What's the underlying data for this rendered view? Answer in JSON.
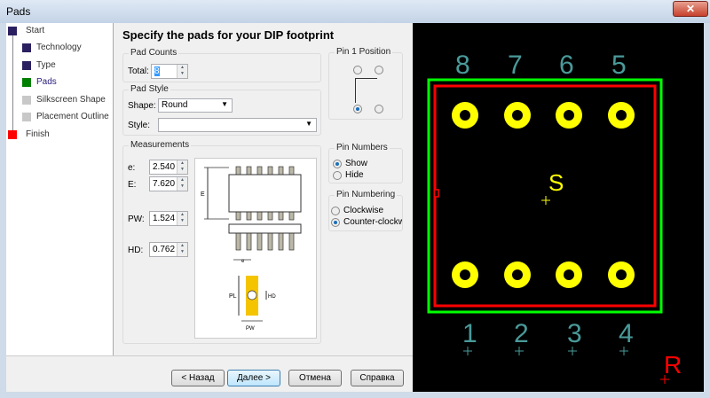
{
  "window": {
    "title": "Pads",
    "close": "✕"
  },
  "sidebar": {
    "items": [
      {
        "label": "Start",
        "color": "#2a2060"
      },
      {
        "label": "Technology",
        "color": "#2a2060"
      },
      {
        "label": "Type",
        "color": "#2a2060"
      },
      {
        "label": "Pads",
        "color": "#008000"
      },
      {
        "label": "Silkscreen Shape",
        "color": "#c8c8c8"
      },
      {
        "label": "Placement Outline",
        "color": "#c8c8c8"
      },
      {
        "label": "Finish",
        "color": "#ff0000"
      }
    ]
  },
  "main": {
    "heading": "Specify the pads for your DIP footprint",
    "pad_counts": {
      "legend": "Pad Counts",
      "total_label": "Total:",
      "total": "8"
    },
    "pad_style": {
      "legend": "Pad Style",
      "shape_label": "Shape:",
      "shape": "Round",
      "style_label": "Style:",
      "style": ""
    },
    "measurements": {
      "legend": "Measurements",
      "e_label": "e:",
      "e": "2.540",
      "E_label": "E:",
      "E": "7.620",
      "PW_label": "PW:",
      "PW": "1.524",
      "HD_label": "HD:",
      "HD": "0.762"
    },
    "diagram": {
      "E": "E",
      "e": "e",
      "PL": "PL",
      "HD": "HD",
      "PW": "PW"
    },
    "pin1": {
      "legend": "Pin 1 Position"
    },
    "pin_numbers": {
      "legend": "Pin Numbers",
      "show": "Show",
      "hide": "Hide"
    },
    "pin_numbering": {
      "legend": "Pin Numbering",
      "cw": "Clockwise",
      "ccw": "Counter-clockwis"
    }
  },
  "buttons": {
    "back": "< Назад",
    "next": "Далее >",
    "cancel": "Отмена",
    "help": "Справка"
  },
  "preview": {
    "top_pins": [
      "8",
      "7",
      "6",
      "5"
    ],
    "bottom_pins": [
      "1",
      "2",
      "3",
      "4"
    ],
    "center": "S",
    "corner": "R"
  }
}
